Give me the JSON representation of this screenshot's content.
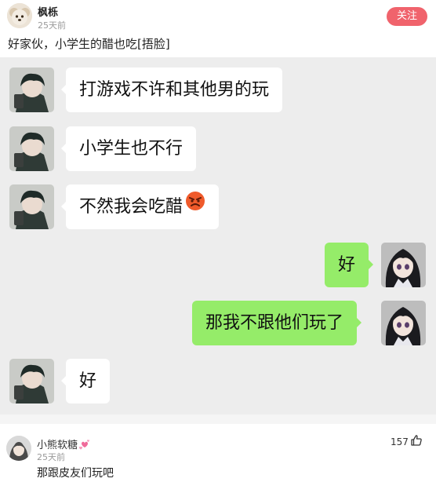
{
  "post": {
    "author": "枫栎",
    "time": "25天前",
    "follow_label": "关注",
    "text": "好家伙，小学生的醋也吃[捂脸]"
  },
  "chat": {
    "messages": [
      {
        "side": "left",
        "text": "打游戏不许和其他男的玩"
      },
      {
        "side": "left",
        "text": "小学生也不行"
      },
      {
        "side": "left",
        "text": "不然我会吃醋",
        "emoji": "angry-face"
      },
      {
        "side": "right",
        "text": "好"
      },
      {
        "side": "right",
        "text": "那我不跟他们玩了"
      },
      {
        "side": "left",
        "text": "好"
      }
    ]
  },
  "comment": {
    "author": "小熊软糖",
    "badge_icon": "hearts-icon",
    "time": "25天前",
    "text": "那跟皮友们玩吧",
    "likes": "157",
    "like_icon": "thumbs-up-icon"
  },
  "colors": {
    "follow_button": "#f0636c",
    "chat_background": "#ededed",
    "right_bubble": "#95ec69",
    "left_bubble": "#ffffff"
  }
}
